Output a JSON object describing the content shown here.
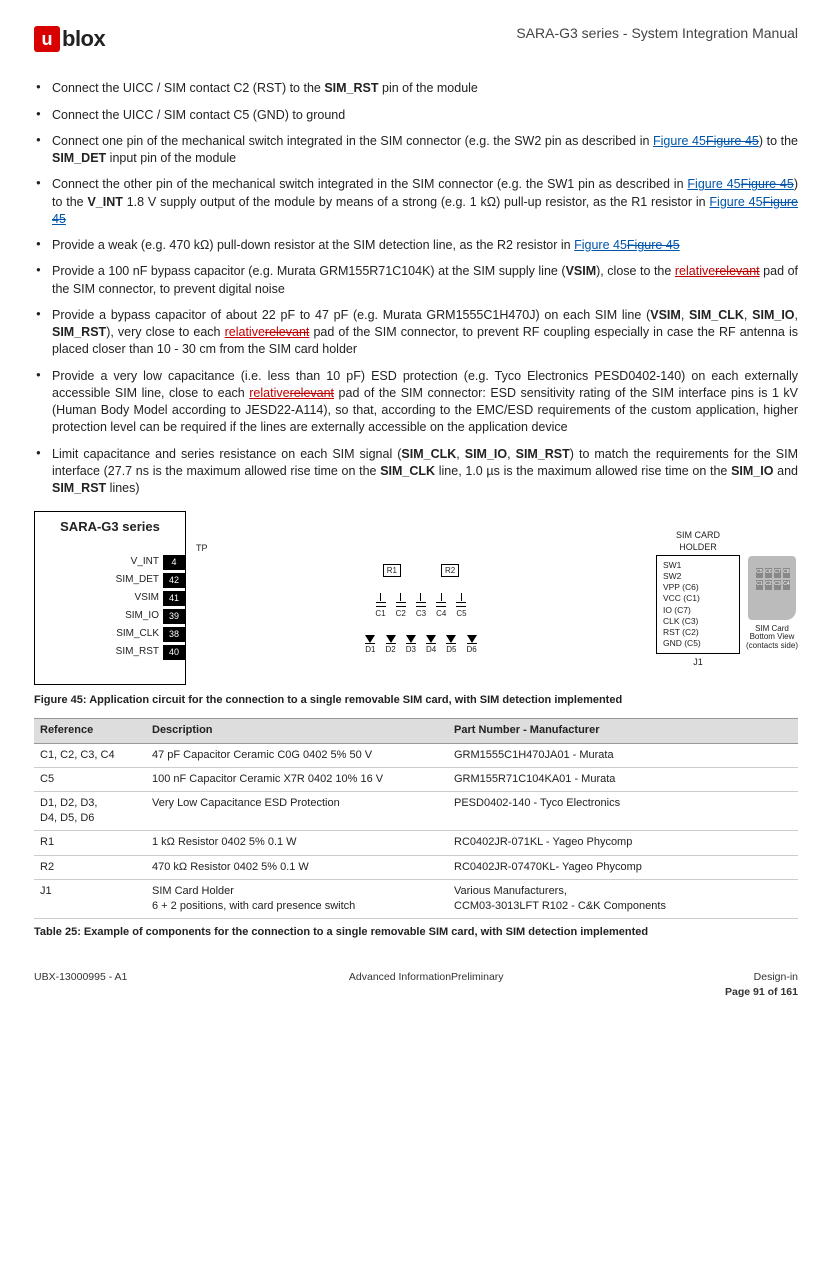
{
  "header": {
    "logo_text": "blox",
    "doc_title": "SARA-G3 series - System Integration Manual"
  },
  "bullets": [
    {
      "pre": "Connect the UICC / SIM contact C2 (RST) to the ",
      "b1": "SIM_RST",
      "post": " pin of the module"
    },
    {
      "pre": "Connect the UICC / SIM contact C5 (GND) to ground"
    },
    {
      "pre": "Connect one pin of the mechanical switch integrated in the SIM connector (e.g. the SW2 pin as described in ",
      "link1": "Figure 45",
      "strike1": "Figure 45",
      "mid": ") to the ",
      "b1": "SIM_DET",
      "post": " input pin of the module"
    },
    {
      "pre": "Connect the other pin of the mechanical switch integrated in the SIM connector (e.g. the SW1 pin as described in ",
      "link1": "Figure 45",
      "strike1": "Figure 45",
      "mid": ") to the ",
      "b1": "V_INT",
      "mid2": " 1.8 V supply output of the module by means of a strong (e.g. 1 kΩ) pull-up resistor, as the R1 resistor in ",
      "link2": "Figure 45",
      "strike2": "Figure 45"
    },
    {
      "pre": "Provide a weak (e.g. 470 kΩ) pull-down resistor at the SIM detection line, as the R2 resistor in ",
      "link1": "Figure 45",
      "strike1": "Figure 45"
    },
    {
      "pre": "Provide a 100 nF bypass capacitor (e.g. Murata GRM155R71C104K) at the SIM supply line (",
      "b1": "VSIM",
      "mid": "), close to the ",
      "relnew": "relative",
      "relold": "relevant",
      "post": " pad of the SIM connector, to prevent digital noise"
    },
    {
      "pre": "Provide a bypass capacitor of about 22 pF to 47 pF (e.g. Murata GRM1555C1H470J) on each SIM line (",
      "b1": "VSIM",
      "sep1": ", ",
      "b2": "SIM_CLK",
      "sep2": ", ",
      "b3": "SIM_IO",
      "sep3": ", ",
      "b4": "SIM_RST",
      "mid": "), very close to each ",
      "relnew": "relative",
      "relold": "relevant",
      "post": " pad of the SIM connector, to prevent RF coupling especially in case the RF antenna is placed closer than 10 - 30 cm from the SIM card holder"
    },
    {
      "pre": "Provide a very low capacitance (i.e. less than 10 pF) ESD protection (e.g. Tyco Electronics PESD0402-140) on each externally accessible SIM line, close to each ",
      "relnew": "relative",
      "relold": "relevant",
      "post": " pad of the SIM connector: ESD sensitivity rating of the SIM interface pins is 1 kV (Human Body Model according to JESD22-A114), so that, according to the EMC/ESD requirements of the custom application, higher protection level can be required if the lines are externally accessible on the application device"
    },
    {
      "pre": "Limit capacitance and series resistance on each SIM signal (",
      "b1": "SIM_CLK",
      "sep1": ", ",
      "b2": "SIM_IO",
      "sep2": ", ",
      "b3": "SIM_RST",
      "mid": ") to match the requirements for the SIM interface (27.7 ns is the maximum allowed rise time on the ",
      "b4": "SIM_CLK",
      "mid2": " line, 1.0 µs is the maximum allowed rise time on the ",
      "b5": "SIM_IO",
      "mid3": " and ",
      "b6": "SIM_RST",
      "post": " lines)"
    }
  ],
  "schematic": {
    "module_title": "SARA-G3 series",
    "tp": "TP",
    "pins": [
      {
        "label": "V_INT",
        "num": "4"
      },
      {
        "label": "SIM_DET",
        "num": "42"
      },
      {
        "label": "VSIM",
        "num": "41"
      },
      {
        "label": "SIM_IO",
        "num": "39"
      },
      {
        "label": "SIM_CLK",
        "num": "38"
      },
      {
        "label": "SIM_RST",
        "num": "40"
      }
    ],
    "r1": "R1",
    "r2": "R2",
    "caps": [
      "C1",
      "C2",
      "C3",
      "C4",
      "C5"
    ],
    "diodes": [
      "D1",
      "D2",
      "D3",
      "D4",
      "D5",
      "D6"
    ],
    "holder_title": "SIM CARD\nHOLDER",
    "holder_pins": [
      "SW1",
      "SW2",
      "VPP (C6)",
      "VCC (C1)",
      "IO (C7)",
      "CLK (C3)",
      "RST (C2)",
      "GND (C5)"
    ],
    "j1": "J1",
    "sim_contacts": [
      "C5",
      "C6",
      "C7",
      "C8",
      "C1",
      "C2",
      "C3",
      "C4"
    ],
    "sim_caption": "SIM Card\nBottom View\n(contacts side)"
  },
  "figure_caption": "Figure 45: Application circuit for the connection to a single removable SIM card, with SIM detection implemented",
  "table": {
    "headers": [
      "Reference",
      "Description",
      "Part Number - Manufacturer"
    ],
    "rows": [
      [
        "C1, C2, C3, C4",
        "47 pF Capacitor Ceramic C0G 0402 5% 50 V",
        "GRM1555C1H470JA01 - Murata"
      ],
      [
        "C5",
        "100 nF Capacitor Ceramic X7R 0402 10% 16 V",
        "GRM155R71C104KA01 - Murata"
      ],
      [
        "D1, D2, D3,\nD4, D5, D6",
        "Very Low Capacitance ESD Protection",
        "PESD0402-140 - Tyco Electronics"
      ],
      [
        "R1",
        "1 kΩ Resistor 0402 5% 0.1 W",
        "RC0402JR-071KL - Yageo Phycomp"
      ],
      [
        "R2",
        "470 kΩ Resistor 0402 5% 0.1 W",
        "RC0402JR-07470KL- Yageo Phycomp"
      ],
      [
        "J1",
        "SIM Card Holder\n6 + 2 positions, with card presence switch",
        "Various Manufacturers,\nCCM03-3013LFT R102 - C&K Components"
      ]
    ]
  },
  "table_caption": "Table 25: Example of components for the connection to a single removable SIM card, with SIM detection implemented",
  "footer": {
    "left": "UBX-13000995 - A1",
    "center": "Advanced InformationPreliminary",
    "right_label": "Design-in",
    "page": "Page 91 of 161"
  }
}
